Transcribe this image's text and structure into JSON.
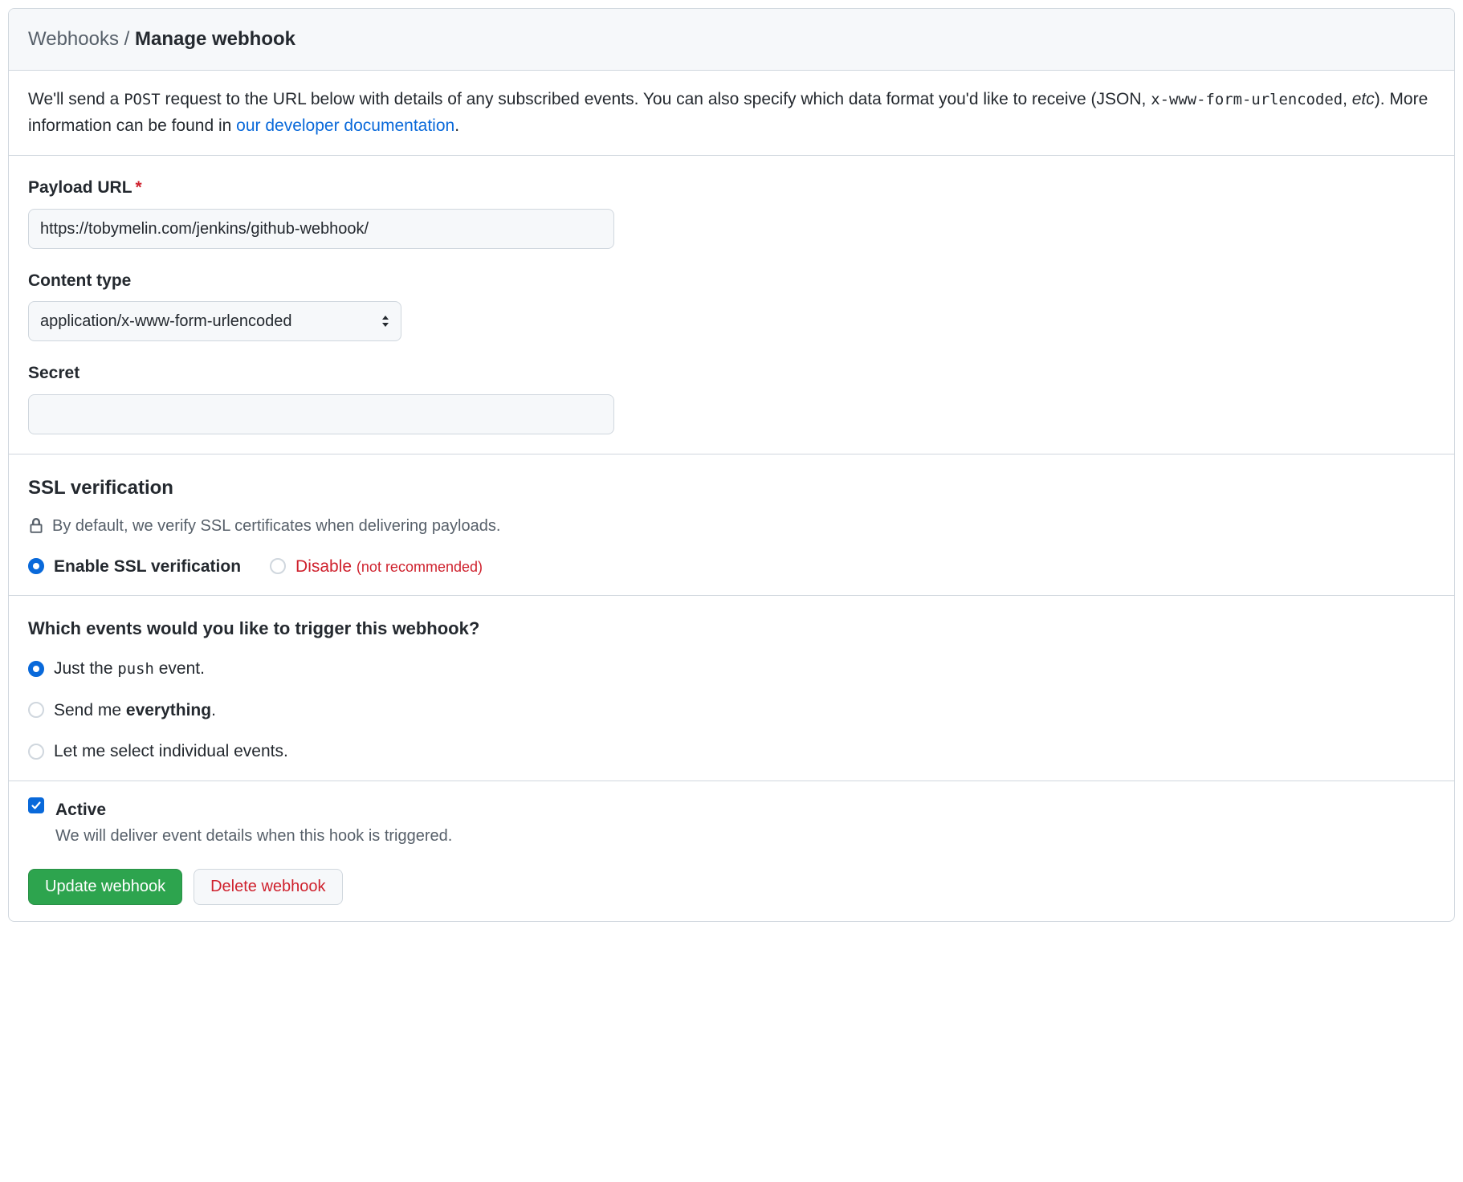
{
  "breadcrumb": {
    "parent": "Webhooks",
    "separator": "/",
    "current": "Manage webhook"
  },
  "description": {
    "prefix": "We'll send a ",
    "code1": "POST",
    "mid1": " request to the URL below with details of any subscribed events. You can also specify which data format you'd like to receive (JSON, ",
    "code2": "x-www-form-urlencoded",
    "mid2": ", ",
    "etc": "etc",
    "mid3": "). More information can be found in ",
    "link_text": "our developer documentation",
    "suffix": "."
  },
  "fields": {
    "payload_url_label": "Payload URL",
    "payload_url_value": "https://tobymelin.com/jenkins/github-webhook/",
    "content_type_label": "Content type",
    "content_type_value": "application/x-www-form-urlencoded",
    "secret_label": "Secret",
    "secret_value": ""
  },
  "ssl": {
    "heading": "SSL verification",
    "note": "By default, we verify SSL certificates when delivering payloads.",
    "enable_label": "Enable SSL verification",
    "disable_label": "Disable",
    "disable_note": "(not recommended)"
  },
  "events": {
    "heading": "Which events would you like to trigger this webhook?",
    "push_prefix": "Just the ",
    "push_code": "push",
    "push_suffix": " event.",
    "everything_prefix": "Send me ",
    "everything_bold": "everything",
    "everything_suffix": ".",
    "individual": "Let me select individual events."
  },
  "active": {
    "label": "Active",
    "note": "We will deliver event details when this hook is triggered."
  },
  "buttons": {
    "update": "Update webhook",
    "delete": "Delete webhook"
  }
}
